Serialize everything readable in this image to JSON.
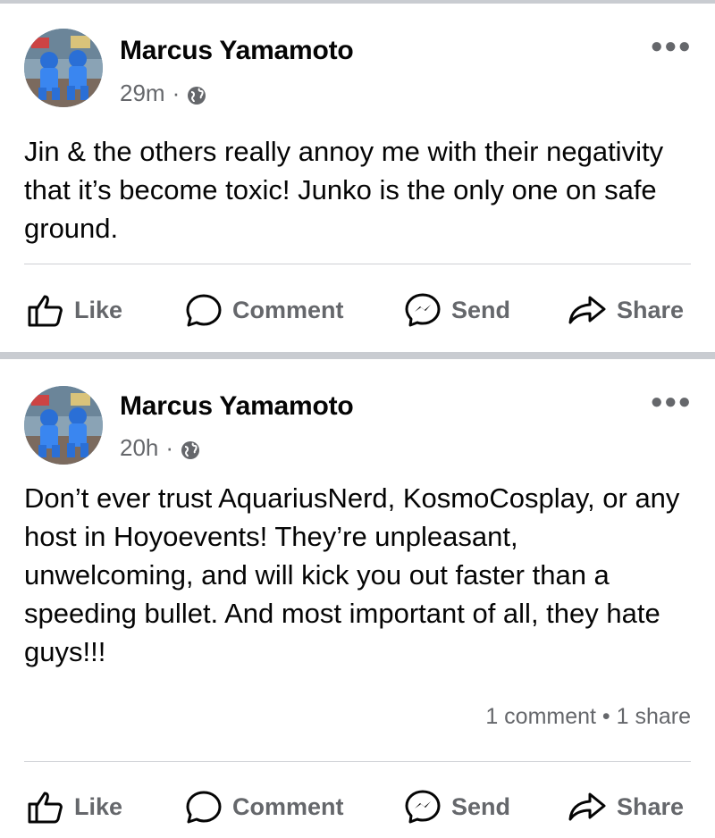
{
  "posts": [
    {
      "author": "Marcus Yamamoto",
      "time": "29m",
      "audience_icon": "globe-icon",
      "text": "Jin & the others really annoy me with their negativity that it’s become toxic! Junko is the only one on safe ground.",
      "counts": "",
      "actions": {
        "like": "Like",
        "comment": "Comment",
        "send": "Send",
        "share": "Share"
      }
    },
    {
      "author": "Marcus Yamamoto",
      "time": "20h",
      "audience_icon": "globe-icon",
      "text": "Don’t ever trust AquariusNerd, KosmoCosplay, or any host in Hoyoevents! They’re unpleasant, unwelcoming, and will kick you out faster than a speeding bullet. And most important of all, they hate guys!!!",
      "counts": "1 comment • 1 share",
      "actions": {
        "like": "Like",
        "comment": "Comment",
        "send": "Send",
        "share": "Share"
      }
    }
  ],
  "separator_symbol": "·",
  "colors": {
    "secondary_text": "#65676b",
    "separator": "#c9ccd1",
    "divider": "#ced0d4"
  }
}
